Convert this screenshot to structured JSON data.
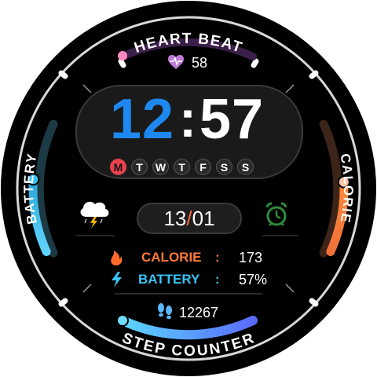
{
  "labels": {
    "heart_beat": "HEART BEAT",
    "battery": "BATTERY",
    "calorie": "CALORIE",
    "step_counter": "STEP COUNTER"
  },
  "heart_rate": "58",
  "time": {
    "hour": "12",
    "separator": ":",
    "minute": "57"
  },
  "weekdays": [
    {
      "letter": "M",
      "active": true
    },
    {
      "letter": "T",
      "active": false
    },
    {
      "letter": "W",
      "active": false
    },
    {
      "letter": "T",
      "active": false
    },
    {
      "letter": "F",
      "active": false
    },
    {
      "letter": "S",
      "active": false
    },
    {
      "letter": "S",
      "active": false
    }
  ],
  "date": {
    "day": "13",
    "slash": "/",
    "month": "01"
  },
  "stats": {
    "calorie": {
      "label": "CALORIE",
      "separator": ":",
      "value": "173"
    },
    "battery": {
      "label": "BATTERY",
      "separator": ":",
      "value": "57%"
    }
  },
  "steps": "12267",
  "icons": {
    "heart": "heart-pulse-icon",
    "weather": "thunderstorm-icon",
    "alarm": "alarm-clock-icon",
    "flame": "flame-icon",
    "bolt": "lightning-bolt-icon",
    "footsteps": "footsteps-icon"
  },
  "gauges": {
    "battery_level": 0.57,
    "calorie_level": 0.55
  },
  "colors": {
    "hour": "#1e88f0",
    "active_day": "#e8414b",
    "calorie": "#ff7a3a",
    "battery": "#39c3f2",
    "step_gradient_start": "#5bd6ff",
    "step_gradient_end": "#5a6cff",
    "heart_arc": "#8a2fb0",
    "alarm": "#2f8a3a"
  }
}
